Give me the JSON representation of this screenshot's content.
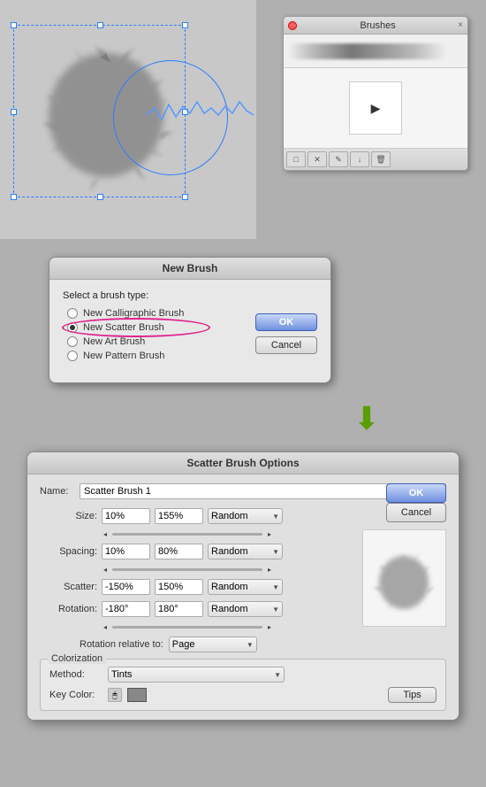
{
  "brushes_panel": {
    "title": "Brushes",
    "close_btn": "×",
    "toolbar_items": [
      "new",
      "delete",
      "options",
      "import",
      "export"
    ]
  },
  "new_brush_dialog": {
    "title": "New Brush",
    "label": "Select a brush type:",
    "options": [
      {
        "id": "calligraphic",
        "label": "New Calligraphic Brush",
        "selected": false
      },
      {
        "id": "scatter",
        "label": "New Scatter Brush",
        "selected": true
      },
      {
        "id": "art",
        "label": "New Art Brush",
        "selected": false
      },
      {
        "id": "pattern",
        "label": "New Pattern Brush",
        "selected": false
      }
    ],
    "ok_label": "OK",
    "cancel_label": "Cancel"
  },
  "scatter_dialog": {
    "title": "Scatter Brush Options",
    "name_label": "Name:",
    "name_value": "Scatter Brush 1",
    "ok_label": "OK",
    "cancel_label": "Cancel",
    "fields": [
      {
        "label": "Size:",
        "val1": "10%",
        "val2": "155%",
        "dropdown": "Random"
      },
      {
        "label": "Spacing:",
        "val1": "10%",
        "val2": "80%",
        "dropdown": "Random"
      },
      {
        "label": "Scatter:",
        "val1": "-150%",
        "val2": "150%",
        "dropdown": "Random"
      },
      {
        "label": "Rotation:",
        "val1": "-180°",
        "val2": "180°",
        "dropdown": "Random"
      }
    ],
    "rotation_relative_label": "Rotation relative to:",
    "rotation_relative_value": "Page",
    "colorization_group_label": "Colorization",
    "method_label": "Method:",
    "method_value": "Tints",
    "key_color_label": "Key Color:",
    "tips_label": "Tips"
  }
}
